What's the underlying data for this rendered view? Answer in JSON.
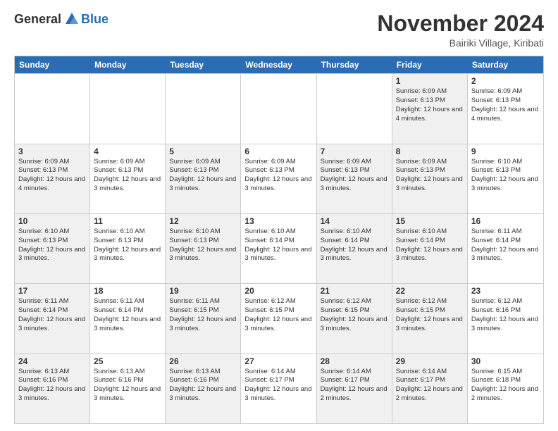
{
  "logo": {
    "general": "General",
    "blue": "Blue"
  },
  "title": "November 2024",
  "location": "Bairiki Village, Kiribati",
  "header_days": [
    "Sunday",
    "Monday",
    "Tuesday",
    "Wednesday",
    "Thursday",
    "Friday",
    "Saturday"
  ],
  "rows": [
    [
      {
        "day": "",
        "info": "",
        "empty": true
      },
      {
        "day": "",
        "info": "",
        "empty": true
      },
      {
        "day": "",
        "info": "",
        "empty": true
      },
      {
        "day": "",
        "info": "",
        "empty": true
      },
      {
        "day": "",
        "info": "",
        "empty": true
      },
      {
        "day": "1",
        "info": "Sunrise: 6:09 AM\nSunset: 6:13 PM\nDaylight: 12 hours and 4 minutes.",
        "shaded": true
      },
      {
        "day": "2",
        "info": "Sunrise: 6:09 AM\nSunset: 6:13 PM\nDaylight: 12 hours and 4 minutes.",
        "shaded": false
      }
    ],
    [
      {
        "day": "3",
        "info": "Sunrise: 6:09 AM\nSunset: 6:13 PM\nDaylight: 12 hours and 4 minutes.",
        "shaded": true
      },
      {
        "day": "4",
        "info": "Sunrise: 6:09 AM\nSunset: 6:13 PM\nDaylight: 12 hours and 3 minutes.",
        "shaded": false
      },
      {
        "day": "5",
        "info": "Sunrise: 6:09 AM\nSunset: 6:13 PM\nDaylight: 12 hours and 3 minutes.",
        "shaded": true
      },
      {
        "day": "6",
        "info": "Sunrise: 6:09 AM\nSunset: 6:13 PM\nDaylight: 12 hours and 3 minutes.",
        "shaded": false
      },
      {
        "day": "7",
        "info": "Sunrise: 6:09 AM\nSunset: 6:13 PM\nDaylight: 12 hours and 3 minutes.",
        "shaded": true
      },
      {
        "day": "8",
        "info": "Sunrise: 6:09 AM\nSunset: 6:13 PM\nDaylight: 12 hours and 3 minutes.",
        "shaded": true
      },
      {
        "day": "9",
        "info": "Sunrise: 6:10 AM\nSunset: 6:13 PM\nDaylight: 12 hours and 3 minutes.",
        "shaded": false
      }
    ],
    [
      {
        "day": "10",
        "info": "Sunrise: 6:10 AM\nSunset: 6:13 PM\nDaylight: 12 hours and 3 minutes.",
        "shaded": true
      },
      {
        "day": "11",
        "info": "Sunrise: 6:10 AM\nSunset: 6:13 PM\nDaylight: 12 hours and 3 minutes.",
        "shaded": false
      },
      {
        "day": "12",
        "info": "Sunrise: 6:10 AM\nSunset: 6:13 PM\nDaylight: 12 hours and 3 minutes.",
        "shaded": true
      },
      {
        "day": "13",
        "info": "Sunrise: 6:10 AM\nSunset: 6:14 PM\nDaylight: 12 hours and 3 minutes.",
        "shaded": false
      },
      {
        "day": "14",
        "info": "Sunrise: 6:10 AM\nSunset: 6:14 PM\nDaylight: 12 hours and 3 minutes.",
        "shaded": true
      },
      {
        "day": "15",
        "info": "Sunrise: 6:10 AM\nSunset: 6:14 PM\nDaylight: 12 hours and 3 minutes.",
        "shaded": true
      },
      {
        "day": "16",
        "info": "Sunrise: 6:11 AM\nSunset: 6:14 PM\nDaylight: 12 hours and 3 minutes.",
        "shaded": false
      }
    ],
    [
      {
        "day": "17",
        "info": "Sunrise: 6:11 AM\nSunset: 6:14 PM\nDaylight: 12 hours and 3 minutes.",
        "shaded": true
      },
      {
        "day": "18",
        "info": "Sunrise: 6:11 AM\nSunset: 6:14 PM\nDaylight: 12 hours and 3 minutes.",
        "shaded": false
      },
      {
        "day": "19",
        "info": "Sunrise: 6:11 AM\nSunset: 6:15 PM\nDaylight: 12 hours and 3 minutes.",
        "shaded": true
      },
      {
        "day": "20",
        "info": "Sunrise: 6:12 AM\nSunset: 6:15 PM\nDaylight: 12 hours and 3 minutes.",
        "shaded": false
      },
      {
        "day": "21",
        "info": "Sunrise: 6:12 AM\nSunset: 6:15 PM\nDaylight: 12 hours and 3 minutes.",
        "shaded": true
      },
      {
        "day": "22",
        "info": "Sunrise: 6:12 AM\nSunset: 6:15 PM\nDaylight: 12 hours and 3 minutes.",
        "shaded": true
      },
      {
        "day": "23",
        "info": "Sunrise: 6:12 AM\nSunset: 6:16 PM\nDaylight: 12 hours and 3 minutes.",
        "shaded": false
      }
    ],
    [
      {
        "day": "24",
        "info": "Sunrise: 6:13 AM\nSunset: 6:16 PM\nDaylight: 12 hours and 3 minutes.",
        "shaded": true
      },
      {
        "day": "25",
        "info": "Sunrise: 6:13 AM\nSunset: 6:16 PM\nDaylight: 12 hours and 3 minutes.",
        "shaded": false
      },
      {
        "day": "26",
        "info": "Sunrise: 6:13 AM\nSunset: 6:16 PM\nDaylight: 12 hours and 3 minutes.",
        "shaded": true
      },
      {
        "day": "27",
        "info": "Sunrise: 6:14 AM\nSunset: 6:17 PM\nDaylight: 12 hours and 3 minutes.",
        "shaded": false
      },
      {
        "day": "28",
        "info": "Sunrise: 6:14 AM\nSunset: 6:17 PM\nDaylight: 12 hours and 2 minutes.",
        "shaded": true
      },
      {
        "day": "29",
        "info": "Sunrise: 6:14 AM\nSunset: 6:17 PM\nDaylight: 12 hours and 2 minutes.",
        "shaded": true
      },
      {
        "day": "30",
        "info": "Sunrise: 6:15 AM\nSunset: 6:18 PM\nDaylight: 12 hours and 2 minutes.",
        "shaded": false
      }
    ]
  ]
}
